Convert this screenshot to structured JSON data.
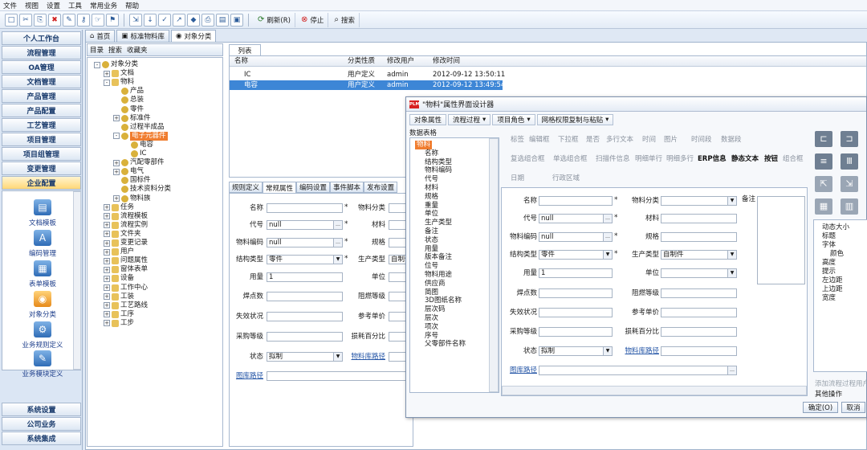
{
  "menubar": [
    "文件",
    "视图",
    "设置",
    "工具",
    "常用业务",
    "帮助"
  ],
  "toolbar": {
    "refresh": "刷新(R)",
    "stop": "停止",
    "search": "搜索"
  },
  "nav": {
    "buttons": [
      "个人工作台",
      "流程管理",
      "OA管理",
      "文档管理",
      "产品管理",
      "产品配置",
      "工艺管理",
      "项目管理",
      "项目组管理",
      "变更管理",
      "企业配置"
    ],
    "modules": [
      "文档模板",
      "编码管理",
      "表单模板",
      "对象分类",
      "业务规则定义",
      "业务模块定义"
    ],
    "bottom": [
      "系统设置",
      "公司业务",
      "系统集成"
    ]
  },
  "tabs": [
    "首页",
    "标准物料库",
    "对象分类"
  ],
  "tree_header": [
    "目录",
    "搜索",
    "收藏夹"
  ],
  "tree": [
    {
      "label": "对象分类",
      "indent": 0,
      "exp": "-"
    },
    {
      "label": "文档",
      "indent": 1,
      "exp": "+"
    },
    {
      "label": "物料",
      "indent": 1,
      "exp": "-"
    },
    {
      "label": "产品",
      "indent": 2,
      "exp": ""
    },
    {
      "label": "总装",
      "indent": 2,
      "exp": ""
    },
    {
      "label": "零件",
      "indent": 2,
      "exp": ""
    },
    {
      "label": "标准件",
      "indent": 2,
      "exp": "+"
    },
    {
      "label": "过程半成品",
      "indent": 2,
      "exp": ""
    },
    {
      "label": "电子元器件",
      "indent": 2,
      "exp": "-",
      "selected": true
    },
    {
      "label": "电容",
      "indent": 3,
      "exp": ""
    },
    {
      "label": "IC",
      "indent": 3,
      "exp": ""
    },
    {
      "label": "汽配零部件",
      "indent": 2,
      "exp": "+"
    },
    {
      "label": "电气",
      "indent": 2,
      "exp": "+"
    },
    {
      "label": "国标件",
      "indent": 2,
      "exp": ""
    },
    {
      "label": "技术资料分类",
      "indent": 2,
      "exp": ""
    },
    {
      "label": "物料族",
      "indent": 2,
      "exp": "+"
    },
    {
      "label": "任务",
      "indent": 1,
      "exp": "+"
    },
    {
      "label": "流程模板",
      "indent": 1,
      "exp": "+"
    },
    {
      "label": "流程实例",
      "indent": 1,
      "exp": "+"
    },
    {
      "label": "文件夹",
      "indent": 1,
      "exp": "+"
    },
    {
      "label": "变更记录",
      "indent": 1,
      "exp": "+"
    },
    {
      "label": "用户",
      "indent": 1,
      "exp": "+"
    },
    {
      "label": "问题属性",
      "indent": 1,
      "exp": "+"
    },
    {
      "label": "窗体表单",
      "indent": 1,
      "exp": "+"
    },
    {
      "label": "设备",
      "indent": 1,
      "exp": "+"
    },
    {
      "label": "工作中心",
      "indent": 1,
      "exp": "+"
    },
    {
      "label": "工装",
      "indent": 1,
      "exp": "+"
    },
    {
      "label": "工艺路线",
      "indent": 1,
      "exp": "+"
    },
    {
      "label": "工序",
      "indent": 1,
      "exp": "+"
    },
    {
      "label": "工步",
      "indent": 1,
      "exp": "+"
    }
  ],
  "list": {
    "tab": "列表",
    "headers": [
      "名称",
      "分类性质",
      "修改用户",
      "修改时间"
    ],
    "rows": [
      [
        "IC",
        "用户定义",
        "admin",
        "2012-09-12 13:50:11"
      ],
      [
        "电容",
        "用户定义",
        "admin",
        "2012-09-12 13:49:54"
      ]
    ]
  },
  "subtabs": [
    "规则定义",
    "常规属性",
    "编码设置",
    "事件脚本",
    "发布设置"
  ],
  "form1": {
    "name": "名称",
    "category": "物料分类",
    "code": "代号",
    "code_val": "null",
    "material": "材料",
    "matcode": "物料编码",
    "matcode_val": "null",
    "spec": "规格",
    "struct": "结构类型",
    "struct_val": "零件",
    "prodtype": "生产类型",
    "prodtype_val": "自制件",
    "usage": "用量",
    "usage_val": "1",
    "unit": "单位",
    "ignite": "焊点数",
    "flame": "阻燃等级",
    "fail": "失效状况",
    "refprice": "参考单价",
    "purchase": "采购等级",
    "loss": "损耗百分比",
    "state": "状态",
    "state_val": "拟制",
    "libpath": "物料库路径",
    "drawpath": "图库路径"
  },
  "dialog": {
    "logo": "PLM",
    "title": "\"物料\"属性界面设计器",
    "tools": [
      "对象属性",
      "流程过程",
      "项目角色",
      "网格权限复制与粘贴"
    ],
    "tabs": [
      "数据表格"
    ],
    "fields": [
      "物料",
      "名称",
      "结构类型",
      "物料编码",
      "代号",
      "材料",
      "规格",
      "重量",
      "单位",
      "生产类型",
      "备注",
      "状态",
      "用量",
      "版本备注",
      "位号",
      "物料用途",
      "供应商",
      "简图",
      "3D图纸名称",
      "层次码",
      "层次",
      "项次",
      "序号",
      "父零部件名称"
    ],
    "palette": {
      "row1": [
        "标签",
        "编辑框",
        "下拉框",
        "是否",
        "多行文本",
        "时间",
        "图片",
        "时间段",
        "数据段"
      ],
      "row2": [
        "复选组合框",
        "单选组合框",
        "扫描件信息",
        "明细单行",
        "明细多行",
        "ERP信息",
        "静态文本",
        "按钮",
        "组合框"
      ],
      "row3": [
        "日期",
        "行政区域"
      ]
    },
    "remark": "备注",
    "props": [
      "动态大小",
      "标题",
      "字体",
      "颜色",
      "高度",
      "提示",
      "左边距",
      "上边距",
      "宽度"
    ],
    "add_process": "添加流程过程用户",
    "other_ops": "其他操作",
    "ok": "确定(O)",
    "cancel": "取消"
  }
}
